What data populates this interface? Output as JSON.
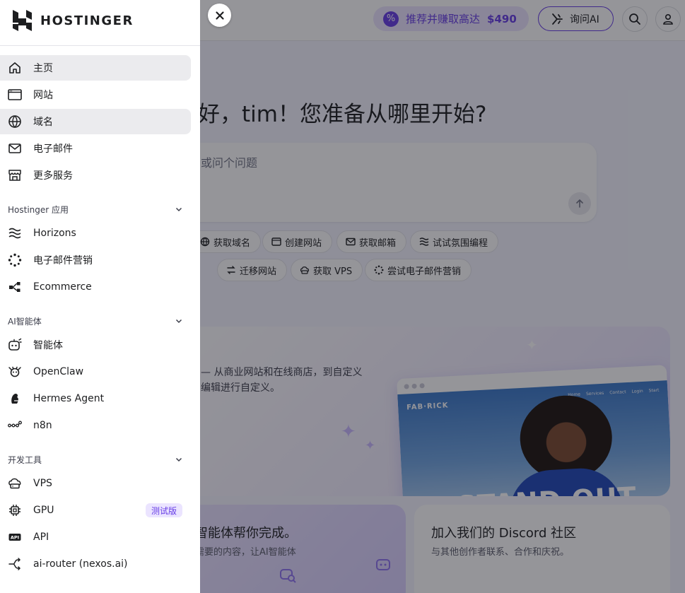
{
  "topbar": {
    "promo_text": "推荐并赚取高达",
    "promo_amount": "$490",
    "ask_ai": "询问AI"
  },
  "main": {
    "greeting": "好，tim！您准备从哪里开始?",
    "ask_placeholder": "或问个问题",
    "chips": [
      {
        "label": "获取域名",
        "icon": "domain-icon"
      },
      {
        "label": "创建网站",
        "icon": "browser-icon"
      },
      {
        "label": "获取邮箱",
        "icon": "mail-icon"
      },
      {
        "label": "试试氛围编程",
        "icon": "horizons-icon"
      },
      {
        "label": "迁移网站",
        "icon": "migrate-icon"
      },
      {
        "label": "获取 VPS",
        "icon": "vps-icon"
      },
      {
        "label": "尝试电子邮件营销",
        "icon": "email-marketing-icon"
      }
    ],
    "hero": {
      "line1": "— 从商业网站和在线商店，到自定义",
      "line2": "编辑进行自定义。",
      "mock_logo": "FAB·RICK",
      "mock_nav": [
        "Home",
        "Services",
        "Contact",
        "Login",
        "Start"
      ],
      "mock_headline": "STAND OUT"
    },
    "card_left": {
      "title": "智能体帮你完成。",
      "sub": "需要的内容，让AI智能体"
    },
    "card_right": {
      "title": "加入我们的 Discord 社区",
      "sub": "与其他创作者联系、合作和庆祝。"
    }
  },
  "sidebar": {
    "brand": "HOSTINGER",
    "items": [
      {
        "label": "主页",
        "icon": "home-icon"
      },
      {
        "label": "网站",
        "icon": "browser-window-icon"
      },
      {
        "label": "域名",
        "icon": "globe-icon"
      },
      {
        "label": "电子邮件",
        "icon": "mail-icon"
      },
      {
        "label": "更多服务",
        "icon": "store-icon"
      }
    ],
    "sections": [
      {
        "title": "Hostinger 应用",
        "items": [
          {
            "label": "Horizons",
            "icon": "horizons-icon"
          },
          {
            "label": "电子邮件营销",
            "icon": "email-marketing-icon"
          },
          {
            "label": "Ecommerce",
            "icon": "ecommerce-icon"
          }
        ]
      },
      {
        "title": "AI智能体",
        "items": [
          {
            "label": "智能体",
            "icon": "agent-bot-icon"
          },
          {
            "label": "OpenClaw",
            "icon": "openclaw-icon"
          },
          {
            "label": "Hermes Agent",
            "icon": "hermes-icon"
          },
          {
            "label": "n8n",
            "icon": "n8n-icon"
          }
        ]
      },
      {
        "title": "开发工具",
        "items": [
          {
            "label": "VPS",
            "icon": "vps-icon"
          },
          {
            "label": "GPU",
            "icon": "chip-icon",
            "badge": "测试版"
          },
          {
            "label": "API",
            "icon": "api-icon"
          },
          {
            "label": "ai-router (nexos.ai)",
            "icon": "router-icon"
          }
        ]
      }
    ]
  },
  "colors": {
    "accent": "#673de6",
    "accent_light": "#ebe4ff",
    "active_bg": "#ebebee",
    "overlay": "rgba(20,20,28,0.45)"
  }
}
